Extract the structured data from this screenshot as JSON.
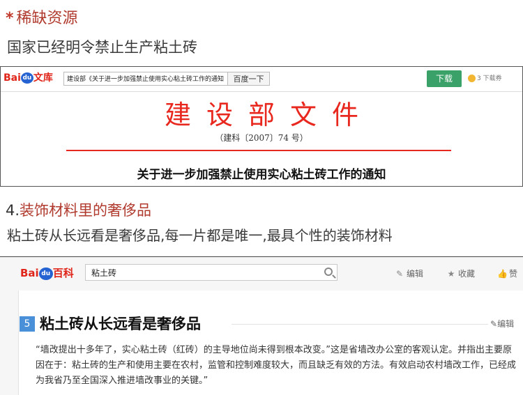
{
  "section1": {
    "title": "稀缺资源",
    "subtitle": "国家已经明令禁止生产粘土砖"
  },
  "wenku": {
    "logo_bai": "Bai",
    "logo_du": "du",
    "logo_name": "文库",
    "search_value": "建设部《关于进一步加强禁止使用实心粘土砖工作的通知",
    "search_button": "百度一下",
    "download_button": "下载",
    "coin_text": "3 下载券",
    "doc_title": "建设部文件",
    "doc_number": "（建科〔2007〕74 号）",
    "doc_notice": "关于进一步加强禁止使用实心粘土砖工作的通知"
  },
  "section4": {
    "number": "4.",
    "title": "装饰材料里的奢侈品",
    "subtitle": "粘土砖从长远看是奢侈品,每一片都是唯一,最具个性的装饰材料"
  },
  "baike": {
    "logo_bai": "Bai",
    "logo_du": "du",
    "logo_name": "百科",
    "search_value": "粘土砖",
    "edit_label": "编辑",
    "collect_label": "收藏",
    "like_label": "赞",
    "section_number": "5",
    "section_title": "粘土砖从长远看是奢侈品",
    "section_edit": "编辑",
    "paragraph": "“墙改提出十多年了，实心粘土砖（红砖）的主导地位尚未得到根本改变。”这是省墙改办公室的客观认定。并指出主要原因在于：粘土砖的生产和使用主要在农村，监管和控制难度较大，而且缺乏有效的方法。有效启动农村墙改工作，已经成为我省乃至全国深入推进墙改事业的关键。”"
  },
  "colors": {
    "accent_red": "#e8281e",
    "heading_red": "#b03a2e",
    "baidu_blue": "#2463d1",
    "download_green": "#3aa168",
    "section_blue": "#4a90d9"
  },
  "icons": [
    "star-icon",
    "baidu-paw-icon",
    "coin-icon",
    "search-icon",
    "pencil-icon",
    "star-outline-icon",
    "thumb-up-icon"
  ]
}
